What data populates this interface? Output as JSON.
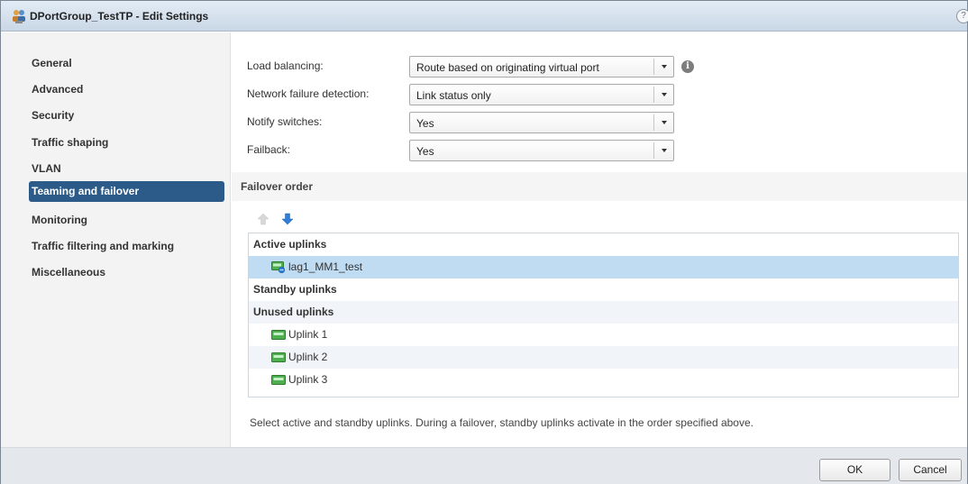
{
  "dialog": {
    "title": "DPortGroup_TestTP - Edit Settings",
    "help_glyph": "?"
  },
  "sidebar": {
    "items": [
      {
        "label": "General"
      },
      {
        "label": "Advanced"
      },
      {
        "label": "Security"
      },
      {
        "label": "Traffic shaping"
      },
      {
        "label": "VLAN"
      },
      {
        "label": "Teaming and failover",
        "selected": true
      },
      {
        "label": "Monitoring"
      },
      {
        "label": "Traffic filtering and marking"
      },
      {
        "label": "Miscellaneous"
      }
    ]
  },
  "form": {
    "load_balancing": {
      "label": "Load balancing:",
      "value": "Route based on originating virtual port"
    },
    "network_failure": {
      "label": "Network failure detection:",
      "value": "Link status only"
    },
    "notify_switches": {
      "label": "Notify switches:",
      "value": "Yes"
    },
    "failback": {
      "label": "Failback:",
      "value": "Yes"
    },
    "info_glyph": "i"
  },
  "failover": {
    "section_title": "Failover order",
    "active_header": "Active uplinks",
    "active_items": [
      "lag1_MM1_test"
    ],
    "standby_header": "Standby uplinks",
    "unused_header": "Unused uplinks",
    "unused_items": [
      "Uplink 1",
      "Uplink 2",
      "Uplink 3"
    ],
    "note": "Select active and standby uplinks. During a failover, standby uplinks activate in the order specified above."
  },
  "buttons": {
    "ok": "OK",
    "cancel": "Cancel"
  },
  "colors": {
    "selected_nav": "#2c5b89",
    "selected_row": "#bfdcf2",
    "arrow_active": "#2f7fd6"
  }
}
